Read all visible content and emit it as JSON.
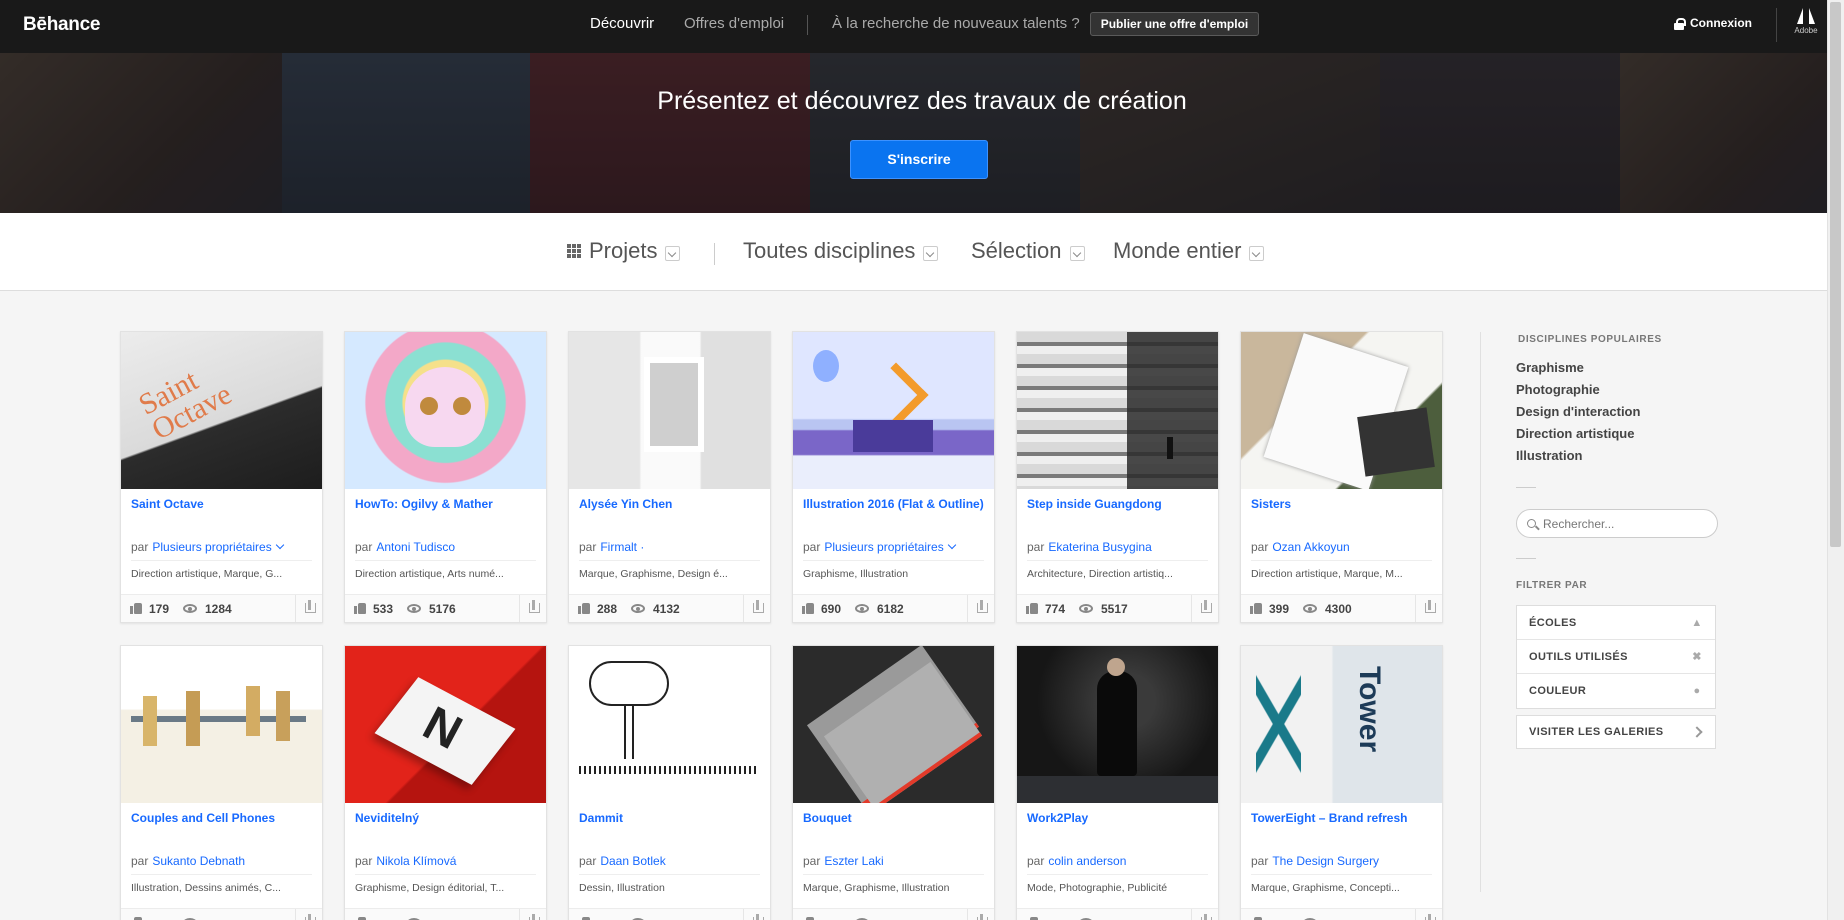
{
  "header": {
    "logo": "Bēhance",
    "nav": [
      "Découvrir",
      "Offres d'emploi"
    ],
    "talent_text": "À la recherche de nouveaux talents ?",
    "post_button": "Publier une offre d'emploi",
    "login": "Connexion",
    "adobe_label": "Adobe"
  },
  "hero": {
    "title": "Présentez et découvrez des travaux de création",
    "signup_button": "S'inscrire"
  },
  "filters": [
    {
      "label": "Projets",
      "icon": "grid-icon"
    },
    {
      "label": "Toutes disciplines"
    },
    {
      "label": "Sélection"
    },
    {
      "label": "Monde entier"
    }
  ],
  "projects": [
    {
      "title": "Saint Octave",
      "by": "par",
      "owner": "Plusieurs propriétaires",
      "multi": true,
      "fields": "Direction artistique, Marque, G...",
      "likes": "179",
      "views": "1284"
    },
    {
      "title": "HowTo: Ogilvy & Mather",
      "by": "par",
      "owner": "Antoni Tudisco",
      "fields": "Direction artistique, Arts numé...",
      "likes": "533",
      "views": "5176"
    },
    {
      "title": "Alysée Yin Chen",
      "by": "par",
      "owner": "Firmalt ·",
      "fields": "Marque, Graphisme, Design é...",
      "likes": "288",
      "views": "4132"
    },
    {
      "title": "Illustration 2016 (Flat & Outline)",
      "by": "par",
      "owner": "Plusieurs propriétaires",
      "multi": true,
      "fields": "Graphisme, Illustration",
      "likes": "690",
      "views": "6182"
    },
    {
      "title": "Step inside Guangdong",
      "by": "par",
      "owner": "Ekaterina Busygina",
      "fields": "Architecture, Direction artistiq...",
      "likes": "774",
      "views": "5517"
    },
    {
      "title": "Sisters",
      "by": "par",
      "owner": "Ozan Akkoyun",
      "fields": "Direction artistique, Marque, M...",
      "likes": "399",
      "views": "4300"
    },
    {
      "title": "Couples and Cell Phones",
      "by": "par",
      "owner": "Sukanto Debnath",
      "fields": "Illustration, Dessins animés, C..."
    },
    {
      "title": "Neviditelný",
      "by": "par",
      "owner": "Nikola Klímová",
      "fields": "Graphisme, Design éditorial, T..."
    },
    {
      "title": "Dammit",
      "by": "par",
      "owner": "Daan Botlek",
      "fields": "Dessin, Illustration"
    },
    {
      "title": "Bouquet",
      "by": "par",
      "owner": "Eszter Laki",
      "fields": "Marque, Graphisme, Illustration"
    },
    {
      "title": "Work2Play",
      "by": "par",
      "owner": "colin anderson",
      "fields": "Mode, Photographie, Publicité"
    },
    {
      "title": "TowerEight – Brand refresh",
      "by": "par",
      "owner": "The Design Surgery",
      "fields": "Marque, Graphisme, Concepti..."
    }
  ],
  "sidebar": {
    "popular_heading": "DISCIPLINES POPULAIRES",
    "disciplines": [
      "Graphisme",
      "Photographie",
      "Design d'interaction",
      "Direction artistique",
      "Illustration"
    ],
    "search_placeholder": "Rechercher...",
    "filter_heading": "FILTRER PAR",
    "filters": [
      "ÉCOLES",
      "OUTILS UTILISÉS",
      "COULEUR"
    ],
    "galleries": "VISITER LES GALERIES"
  },
  "colors": {
    "accent": "#1769ff",
    "signup": "#0a74f0",
    "topbar": "#191919"
  }
}
